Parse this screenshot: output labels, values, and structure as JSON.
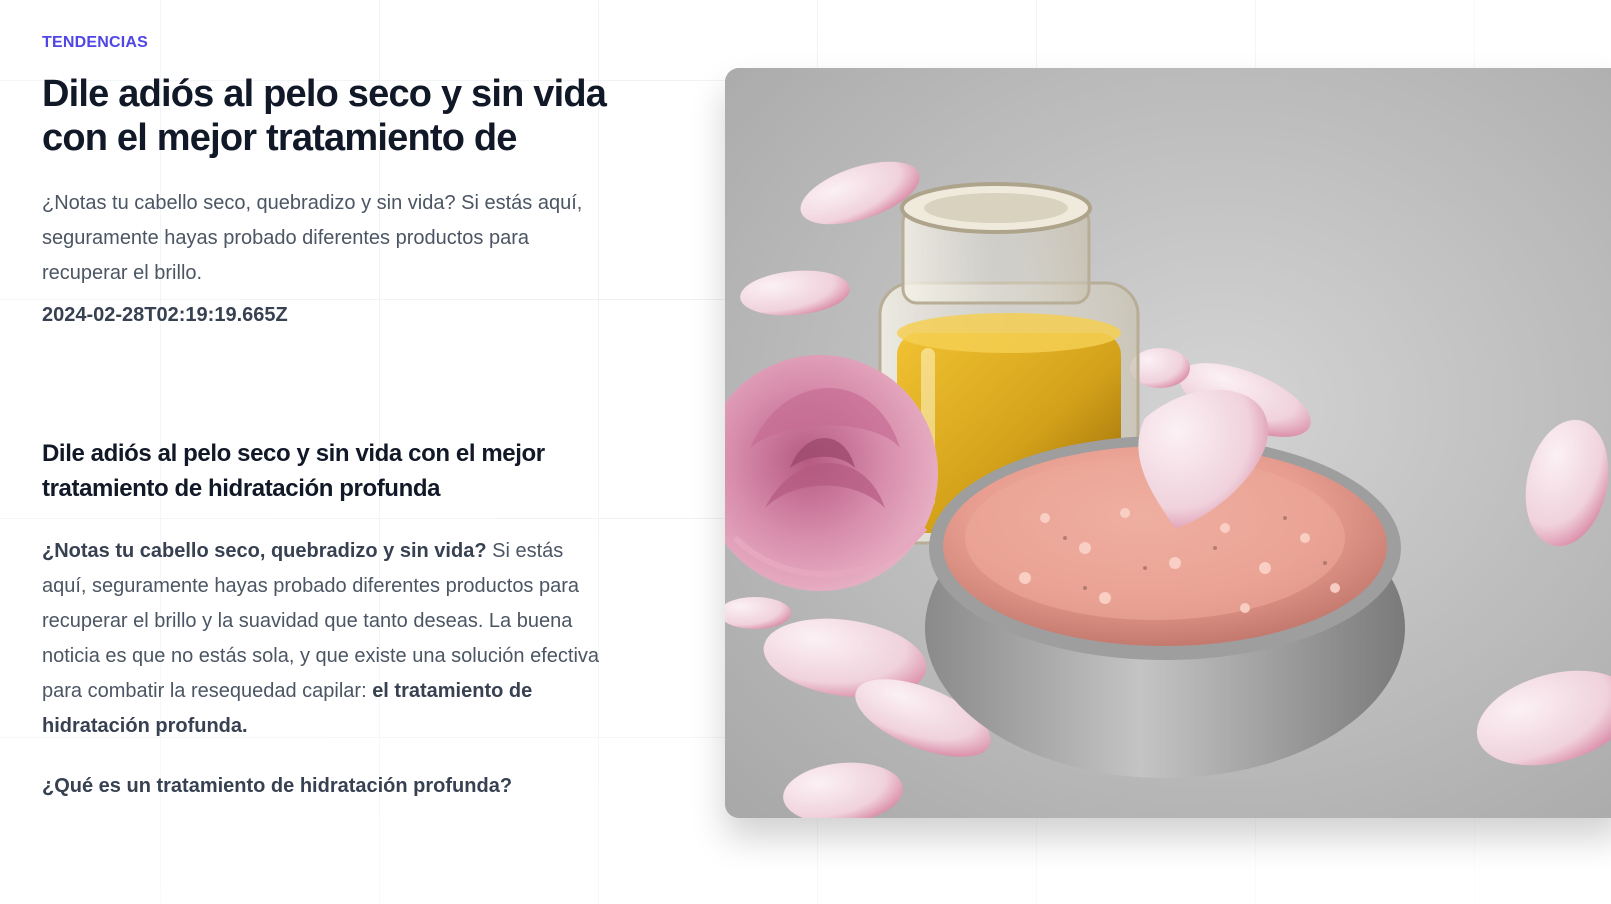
{
  "article": {
    "category": "TENDENCIAS",
    "title": "Dile adiós al pelo seco y sin vida con el mejor tratamiento de",
    "excerpt": "¿Notas tu cabello seco, quebradizo y sin vida? Si estás aquí, seguramente hayas probado diferentes productos para recuperar el brillo.",
    "date": "2024-02-28T02:19:19.665Z",
    "heading": "Dile adiós al pelo seco y sin vida con el mejor tratamiento de hidratación profunda",
    "intro_bold": "¿Notas tu cabello seco, quebradizo y sin vida?",
    "intro_text": " Si estás aquí, seguramente hayas probado diferentes productos para recuperar el brillo y la suavidad que tanto deseas. La buena noticia es que no estás sola, y que existe una solución efectiva para combatir la resequedad capilar: ",
    "intro_end_bold": "el tratamiento de hidratación profunda.",
    "subheading": "¿Qué es un tratamiento de hidratación profunda?"
  },
  "hero_image": {
    "subject": "pink salt scrub bowl with oil bottle, rose and petals",
    "colors": {
      "background": "#c9c9c9",
      "oil": "#d4a21a",
      "salt": "#e8a59a",
      "rose": "#d58aa8",
      "petal": "#f3dbe3"
    }
  }
}
